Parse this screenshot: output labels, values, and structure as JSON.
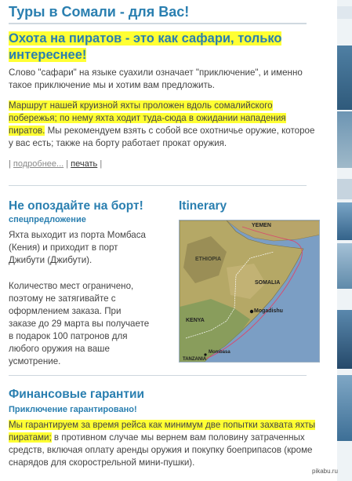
{
  "page": {
    "title": "Туры в Сомали - для Вас!"
  },
  "article": {
    "heading_line1": "Охота на пиратов - это как сафари, только",
    "heading_line2": "интереснее!",
    "intro_line1": "Слово \"сафари\" на языке суахили означает \"приключение\", и именно",
    "intro_line2": "такое приключение мы и хотим вам предложить.",
    "route_line1": "Маршрут нашей круизной яхты проложен вдоль сомалийского",
    "route_line2": "побережья; по нему яхта ходит туда-сюда в ожидании нападения",
    "route_line3a": "пиратов.",
    "route_line3b": " Мы рекомендуем взять с собой все охотничье оружие, которое",
    "route_line4": "у вас есть; также на борту работает прокат оружия.",
    "link_sep1": "|",
    "link_more": "подробнее...",
    "link_sep2": "|",
    "link_print": "печать",
    "link_sep3": "|"
  },
  "boarding": {
    "heading": "Не опоздайте на борт!",
    "subheading": "спецпредложение",
    "p1_line1": "Яхта выходит из порта Момбаса",
    "p1_line2": "(Кения) и приходит в порт",
    "p1_line3": "Джибути (Джибути).",
    "p2_line1": "Количество мест ограничено,",
    "p2_line2": "поэтому не затягивайте с",
    "p2_line3": "оформлением заказа. При",
    "p2_line4": "заказе до 29 марта вы получаете",
    "p2_line5": "в подарок 100 патронов для",
    "p2_line6": "любого оружия на ваше",
    "p2_line7": "усмотрение."
  },
  "itinerary": {
    "heading": "Itinerary",
    "labels": {
      "yemen": "YEMEN",
      "ethiopia": "ETHIOPIA",
      "somalia": "SOMALIA",
      "kenya": "KENYA",
      "mogadishu": "Mogadishu",
      "mombasa": "Mombasa",
      "tanzania": "TANZANIA"
    }
  },
  "guarantees": {
    "heading": "Финансовые гарантии",
    "subheading": "Приключение гарантировано!",
    "line1": "Мы гарантируем за время рейса как минимум две попытки захвата яхты",
    "line2a": "пиратами;",
    "line2b": " в противном случае мы вернем вам половину затраченных",
    "line3": "средств, включая оплату аренды оружия и покупку боеприпасов (кроме",
    "line4": "снарядов для скорострельной мини-пушки)."
  },
  "watermark": "pikabu.ru",
  "colors": {
    "heading_blue": "#2a7fb0",
    "highlight_yellow": "#ffff33",
    "body_text": "#444444"
  }
}
